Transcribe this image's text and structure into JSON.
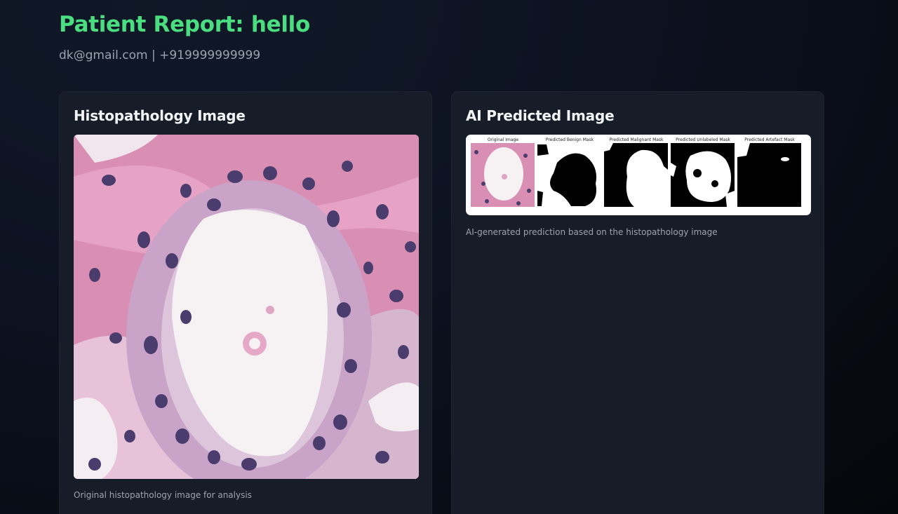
{
  "header": {
    "title": "Patient Report: hello",
    "contact": "dk@gmail.com | +919999999999"
  },
  "left_card": {
    "title": "Histopathology Image",
    "caption": "Original histopathology image for analysis"
  },
  "right_card": {
    "title": "AI Predicted Image",
    "caption": "AI-generated prediction based on the histopathology image",
    "panels": [
      "Original Image",
      "Predicted Benign Mask",
      "Predicted Malignant Mask",
      "Predicted Unlabeled Mask",
      "Predicted Artefact Mask"
    ]
  },
  "colors": {
    "title_green": "#4ade80",
    "card_bg": "#161d29",
    "tissue_pink": "#d98fb3",
    "nucleus_purple": "#4a3d6e"
  }
}
